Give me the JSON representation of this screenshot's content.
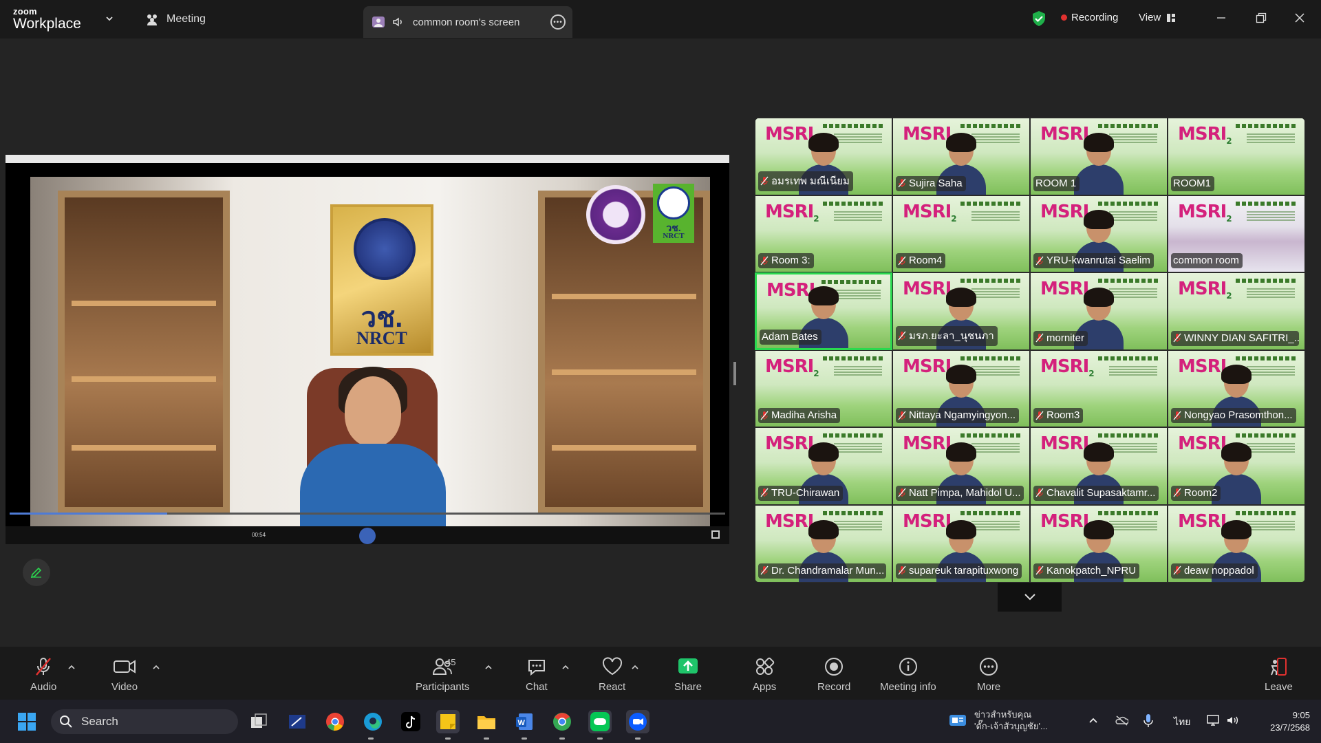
{
  "app": {
    "logo_line1": "zoom",
    "logo_line2": "Workplace",
    "meeting_tab": "Meeting",
    "screen_tab": "common room's screen",
    "recording": "Recording",
    "view": "View",
    "brand_color": "#2ad94f"
  },
  "shared_screen": {
    "plaque_text1": "วช.",
    "plaque_text2": "NRCT",
    "emblem_text1": "วช.",
    "emblem_text2": "NRCT",
    "timestamp": "00:54",
    "progress": 0.22
  },
  "gallery": {
    "tile_logo": "MSRI",
    "tile_logo_num": "2",
    "participants": [
      {
        "name": "อมรเทพ มณีเนียม",
        "video": true
      },
      {
        "name": "Sujira Saha",
        "video": true
      },
      {
        "name": "ROOM 1",
        "video": true
      },
      {
        "name": "ROOM1",
        "video": false
      },
      {
        "name": "Room 3:",
        "video": false
      },
      {
        "name": "Room4",
        "video": false
      },
      {
        "name": "YRU-kwanrutai Saelim",
        "video": true
      },
      {
        "name": "common room",
        "video": true,
        "room": true
      },
      {
        "name": "Adam Bates",
        "video": true,
        "active": true
      },
      {
        "name": "มรภ.ยะลา_นุชนภา",
        "video": true
      },
      {
        "name": "morniter",
        "video": true
      },
      {
        "name": "WINNY DIAN SAFITRI_...",
        "video": false
      },
      {
        "name": "Madiha Arisha",
        "video": false
      },
      {
        "name": "Nittaya Ngamyingyon...",
        "video": true
      },
      {
        "name": "Room3",
        "video": false
      },
      {
        "name": "Nongyao Prasomthon...",
        "video": true
      },
      {
        "name": "TRU-Chirawan",
        "video": true
      },
      {
        "name": "Natt Pimpa, Mahidol U...",
        "video": true
      },
      {
        "name": "Chavalit Supasaktamr...",
        "video": true
      },
      {
        "name": "Room2",
        "video": true
      },
      {
        "name": "Dr. Chandramalar Mun...",
        "video": true
      },
      {
        "name": "supareuk tarapituxwong",
        "video": true
      },
      {
        "name": "Kanokpatch_NPRU",
        "video": true
      },
      {
        "name": "deaw noppadol",
        "video": true
      }
    ]
  },
  "toolbar": {
    "audio": "Audio",
    "video": "Video",
    "participants": "Participants",
    "participants_count": "45",
    "chat": "Chat",
    "react": "React",
    "share": "Share",
    "apps": "Apps",
    "record": "Record",
    "meeting_info": "Meeting info",
    "more": "More",
    "leave": "Leave"
  },
  "taskbar": {
    "search_placeholder": "Search",
    "news_line1": "ข่าวสำหรับคุณ",
    "news_line2": "'ตั๊ก-เจ้าสัวบุญชัย'...",
    "lang": "ไทย",
    "time": "9:05",
    "date": "23/7/2568"
  }
}
